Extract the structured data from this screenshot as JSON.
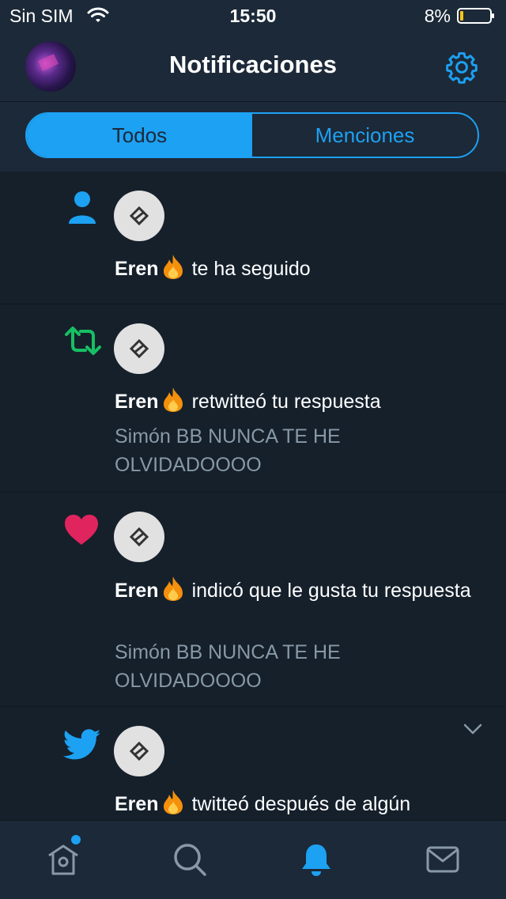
{
  "status_bar": {
    "carrier": "Sin SIM",
    "time": "15:50",
    "battery": "8%"
  },
  "header": {
    "title": "Notificaciones"
  },
  "segmented": {
    "all": "Todos",
    "mentions": "Menciones"
  },
  "notifications": [
    {
      "type": "follow",
      "user": "Eren",
      "action": "te ha seguido",
      "quote": ""
    },
    {
      "type": "retweet",
      "user": "Eren",
      "action": "retwitteó tu respuesta",
      "quote": "Simón BB NUNCA TE HE OLVIDADOOOO"
    },
    {
      "type": "like",
      "user": "Eren",
      "action": "indicó que le gusta tu respuesta",
      "quote": "Simón BB NUNCA TE HE OLVIDADOOOO"
    },
    {
      "type": "tweet",
      "user": "Eren",
      "action": "twitteó después de algún",
      "quote": ""
    }
  ],
  "colors": {
    "accent": "#1da1f2",
    "retweet": "#17bf63",
    "like": "#e0245e",
    "background": "#15202b",
    "bar": "#1c2938"
  },
  "icons": [
    "wifi-icon",
    "battery-icon",
    "settings-gear-icon",
    "person-icon",
    "retweet-icon",
    "heart-icon",
    "bird-icon",
    "chevron-down-icon",
    "home-icon",
    "search-icon",
    "bell-icon",
    "mail-icon",
    "fire-emoji"
  ]
}
